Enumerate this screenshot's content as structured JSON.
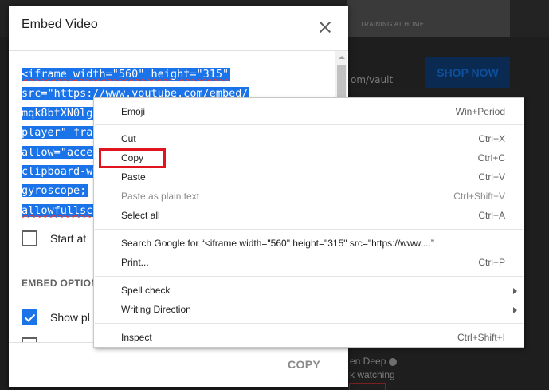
{
  "background": {
    "thumb_text": "TRAINING AT HOME",
    "url_fragment": "om/vault",
    "shop_button": "SHOP NOW",
    "channel_name": "en Deep",
    "watching": "k watching"
  },
  "dialog": {
    "title": "Embed Video",
    "code_lines": [
      "<iframe width=\"560\" height=\"315\"",
      "src=\"https://www.youtube.com/embed/",
      "mqk8btXN0lg",
      "player\" fra",
      "allow=\"acce",
      "clipboard-w",
      "gyroscope;",
      "allowfullsc"
    ],
    "start_at_label": "Start at",
    "embed_options_heading": "EMBED OPTION",
    "show_player_label": "Show pl",
    "copy_button": "COPY"
  },
  "context_menu": {
    "items": [
      {
        "label": "Emoji",
        "shortcut": "Win+Period"
      },
      {
        "label": "Cut",
        "shortcut": "Ctrl+X"
      },
      {
        "label": "Copy",
        "shortcut": "Ctrl+C"
      },
      {
        "label": "Paste",
        "shortcut": "Ctrl+V"
      },
      {
        "label": "Paste as plain text",
        "shortcut": "Ctrl+Shift+V"
      },
      {
        "label": "Select all",
        "shortcut": "Ctrl+A"
      },
      {
        "label": "Search Google for “<iframe width=\"560\" height=\"315\" src=\"https://www....”",
        "shortcut": ""
      },
      {
        "label": "Print...",
        "shortcut": "Ctrl+P"
      },
      {
        "label": "Spell check",
        "shortcut": ""
      },
      {
        "label": "Writing Direction",
        "shortcut": ""
      },
      {
        "label": "Inspect",
        "shortcut": "Ctrl+Shift+I"
      }
    ]
  },
  "colors": {
    "selection": "#1a73e8",
    "highlight_box": "#e0141e",
    "checkbox_checked": "#1a73e8"
  }
}
